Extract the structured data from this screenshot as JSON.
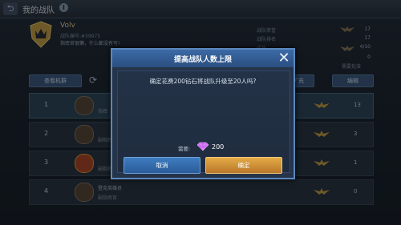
{
  "header": {
    "title": "我的战队",
    "back_icon": "back-arrow-icon",
    "info_icon": "info-icon"
  },
  "team": {
    "name": "Volv",
    "id": "战队编号:#39975",
    "motto": "指挥官很懒，什么都没有写!"
  },
  "stats": [
    {
      "label": "战队荣誉",
      "value": "17"
    },
    {
      "label": "战队排名",
      "value": "17"
    },
    {
      "label": "成员",
      "value": "4/10"
    },
    {
      "label": "",
      "value": "0"
    }
  ],
  "stats_extra": "需要批准",
  "buttons": {
    "view": "查看机群",
    "expand": "扩充",
    "edit": "编辑"
  },
  "members": [
    {
      "rank": "1",
      "name": "",
      "role": "指挥",
      "value": "13"
    },
    {
      "rank": "2",
      "name": "",
      "role": "副指挥",
      "value": "3"
    },
    {
      "rank": "3",
      "name": "",
      "role": "副指挥",
      "value": "1"
    },
    {
      "rank": "4",
      "name": "登克英雄员",
      "role": "副指挥官",
      "value": "0"
    }
  ],
  "dialog": {
    "title": "提高战队人数上限",
    "message": "确定花费200钻石将战队升级至20人吗?",
    "cost_label": "需要:",
    "cost_value": "200",
    "cancel": "取消",
    "confirm": "确定"
  },
  "colors": {
    "accent": "#3c6aa6",
    "confirm": "#d39a3a",
    "gem": "#c65cf0"
  }
}
